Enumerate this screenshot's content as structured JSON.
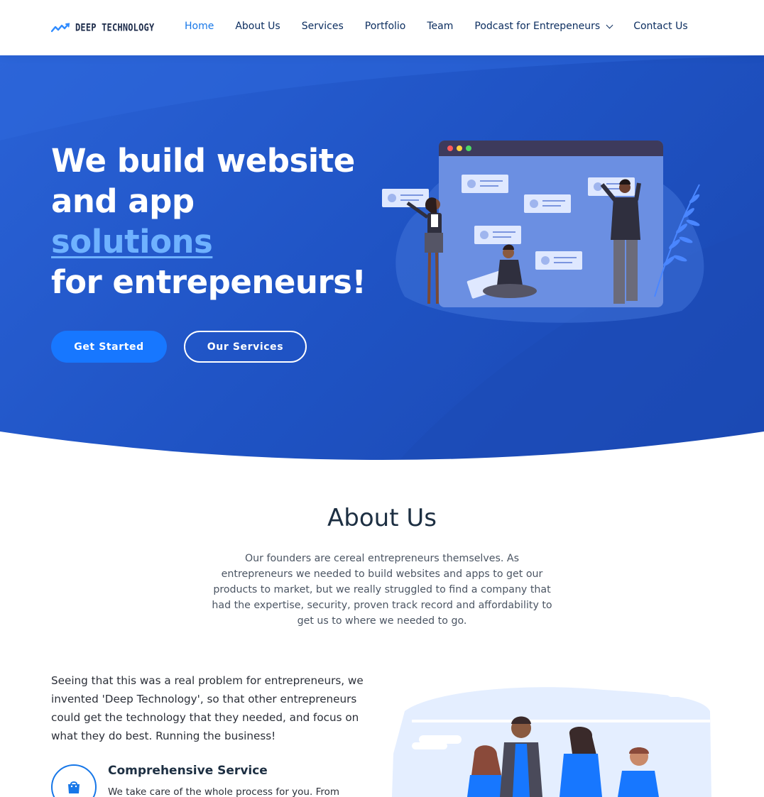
{
  "header": {
    "logo_text": "DEEP TECHNOLOGY",
    "nav": [
      {
        "label": "Home",
        "active": true
      },
      {
        "label": "About Us"
      },
      {
        "label": "Services"
      },
      {
        "label": "Portfolio"
      },
      {
        "label": "Team"
      },
      {
        "label": "Podcast for Entrepeneurs",
        "has_dropdown": true
      },
      {
        "label": "Contact Us"
      }
    ]
  },
  "hero": {
    "line1": "We build website",
    "line2": "and app",
    "line3": "solutions",
    "line4": "for entrepeneurs!",
    "primary_button": "Get Started",
    "secondary_button": "Our Services"
  },
  "about": {
    "title": "About Us",
    "intro": "Our founders are cereal entrepreneurs themselves. As entrepreneurs we needed to build websites and apps to get our products to market, but we really struggled to find a company that had the expertise, security, proven track record and affordability to get us to where we needed to go.",
    "body": "Seeing that this was a real problem for entrepreneurs, we invented 'Deep Technology', so that other entrepreneurs could get the technology that they needed, and focus on what they do best. Running the business!",
    "feature_title": "Comprehensive Service",
    "feature_text": "We take care of the whole process for you. From nothing"
  },
  "colors": {
    "accent": "#1777e8",
    "hero_bg": "#2159cb",
    "nav_text": "#0c2e60",
    "highlight": "#6fb2ff"
  },
  "icons": [
    "logo-wave-icon",
    "chevron-down-icon",
    "shopping-bag-icon"
  ]
}
